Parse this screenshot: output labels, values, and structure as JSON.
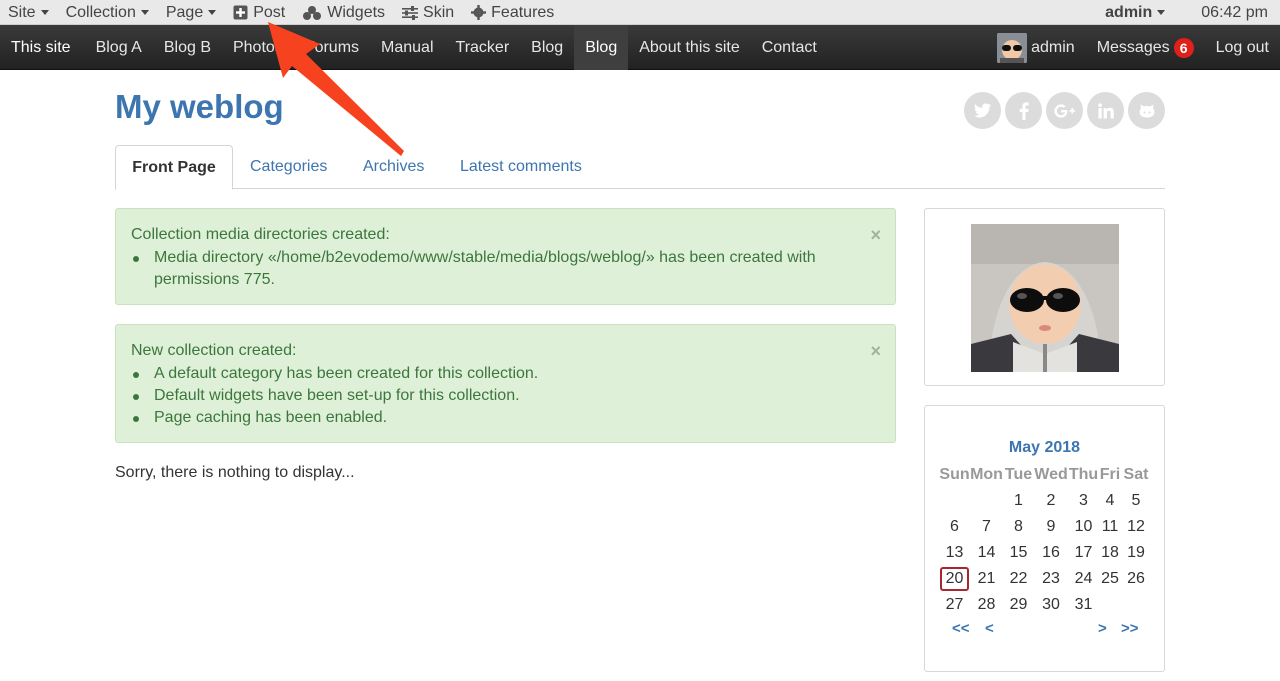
{
  "evobar": {
    "site_label": "Site",
    "collection_label": "Collection",
    "page_label": "Page",
    "post_label": "Post",
    "widgets_label": "Widgets",
    "skin_label": "Skin",
    "features_label": "Features",
    "user_label": "admin",
    "time": "06:42 pm"
  },
  "sitenav": {
    "items": [
      "This site",
      "Blog A",
      "Blog B",
      "Photos",
      "Forums",
      "Manual",
      "Tracker",
      "Blog",
      "Blog",
      "About this site",
      "Contact"
    ],
    "active_index": 8,
    "user_label": "admin",
    "messages_label": "Messages",
    "messages_count": "6",
    "logout_label": "Log out"
  },
  "page": {
    "title": "My weblog",
    "social_icons": [
      "twitter-icon",
      "facebook-icon",
      "google-plus-icon",
      "linkedin-icon",
      "github-icon"
    ],
    "tabs": [
      "Front Page",
      "Categories",
      "Archives",
      "Latest comments"
    ],
    "active_tab": 0
  },
  "alerts": [
    {
      "title": "Collection media directories created:",
      "items": [
        "Media directory «/home/b2evodemo/www/stable/media/blogs/weblog/» has been created with permissions 775."
      ]
    },
    {
      "title": "New collection created:",
      "items": [
        "A default category has been created for this collection.",
        "Default widgets have been set-up for this collection.",
        "Page caching has been enabled."
      ]
    }
  ],
  "empty_message": "Sorry, there is nothing to display...",
  "calendar": {
    "title": "May 2018",
    "weekdays": [
      "Sun",
      "Mon",
      "Tue",
      "Wed",
      "Thu",
      "Fri",
      "Sat"
    ],
    "weeks": [
      [
        "",
        "",
        "1",
        "2",
        "3",
        "4",
        "5"
      ],
      [
        "6",
        "7",
        "8",
        "9",
        "10",
        "11",
        "12"
      ],
      [
        "13",
        "14",
        "15",
        "16",
        "17",
        "18",
        "19"
      ],
      [
        "20",
        "21",
        "22",
        "23",
        "24",
        "25",
        "26"
      ],
      [
        "27",
        "28",
        "29",
        "30",
        "31",
        "",
        ""
      ]
    ],
    "today": "20",
    "nav": {
      "prev_year": "<<",
      "prev_month": "<",
      "next_month": ">",
      "next_year": ">>"
    }
  },
  "colors": {
    "link": "#3d75b0",
    "alert_bg": "#dff0d8",
    "alert_text": "#3c763d",
    "badge": "#e0201b",
    "arrow": "#f7421f"
  }
}
